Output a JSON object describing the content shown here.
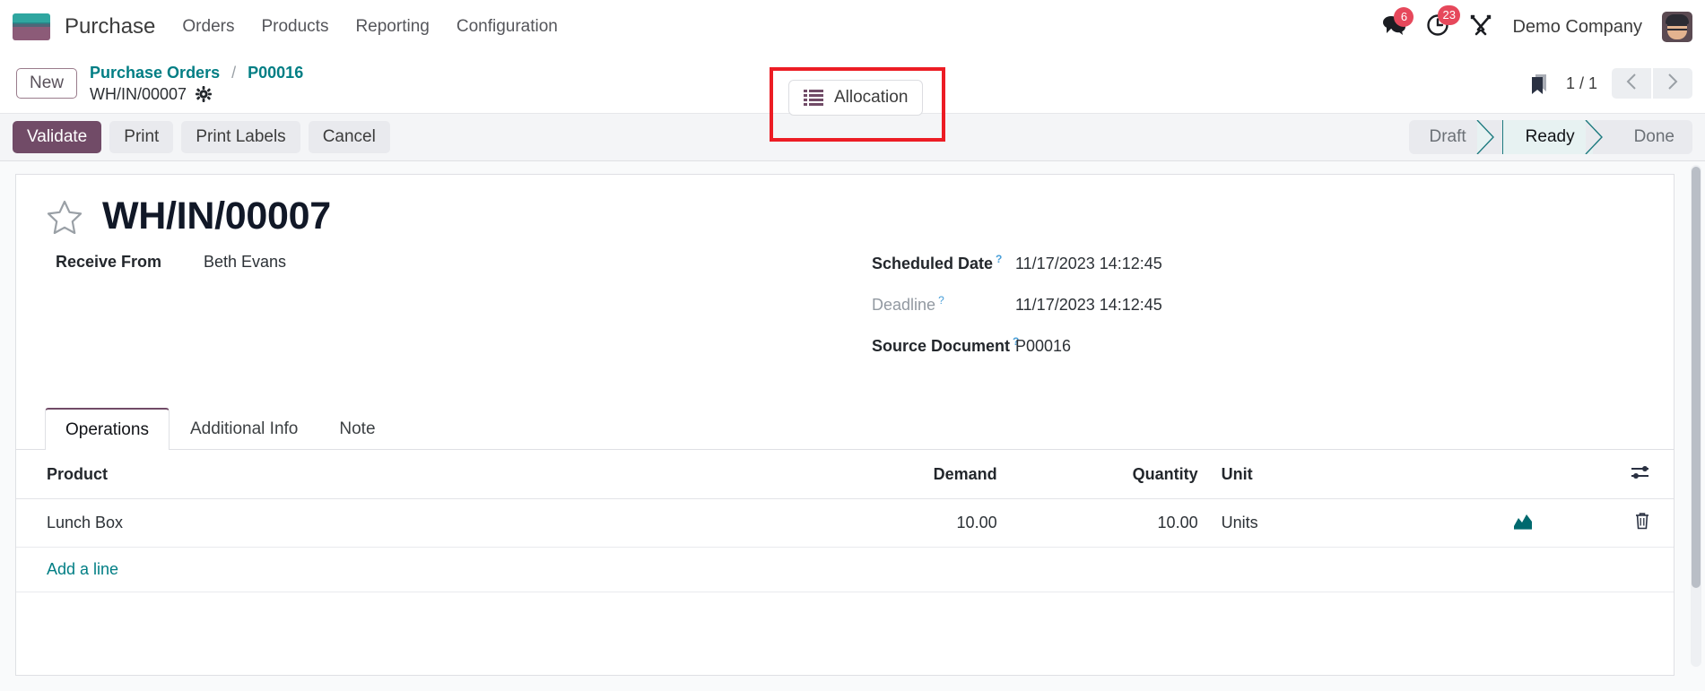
{
  "navbar": {
    "app_logo_icon": "purchase-app-logo",
    "app_title": "Purchase",
    "menu": [
      {
        "label": "Orders"
      },
      {
        "label": "Products"
      },
      {
        "label": "Reporting"
      },
      {
        "label": "Configuration"
      }
    ],
    "messages": {
      "icon": "chat-bubbles-icon",
      "count": "6"
    },
    "activities": {
      "icon": "clock-icon",
      "count": "23"
    },
    "tools": {
      "icon": "tools-wrench-icon"
    },
    "company": "Demo Company",
    "avatar_icon": "user-avatar"
  },
  "breadcrumb": {
    "new_button": "New",
    "links": [
      {
        "label": "Purchase Orders"
      },
      {
        "label": "P00016"
      }
    ],
    "separator": "/",
    "current": "WH/IN/00007",
    "settings_icon": "gear-icon"
  },
  "allocation": {
    "label": "Allocation",
    "icon": "list-lines-icon",
    "highlight_color": "#ec1c24"
  },
  "pager": {
    "bookmark_icon": "bookmark-icon",
    "count": "1 / 1",
    "prev_icon": "chevron-left-icon",
    "next_icon": "chevron-right-icon"
  },
  "actions": {
    "primary": "Validate",
    "secondary": [
      {
        "label": "Print"
      },
      {
        "label": "Print Labels"
      },
      {
        "label": "Cancel"
      }
    ],
    "primary_color": "#714b67"
  },
  "status": {
    "items": [
      {
        "label": "Draft",
        "active": false
      },
      {
        "label": "Ready",
        "active": true
      },
      {
        "label": "Done",
        "active": false
      }
    ],
    "active_color": "#1d7a7f"
  },
  "record": {
    "favorite_icon": "star-outline-icon",
    "title": "WH/IN/00007",
    "left_fields": [
      {
        "label": "Receive From",
        "value": "Beth Evans",
        "help": false,
        "muted": false
      }
    ],
    "right_fields": [
      {
        "label": "Scheduled Date",
        "value": "11/17/2023 14:12:45",
        "help": "?",
        "muted": false
      },
      {
        "label": "Deadline",
        "value": "11/17/2023 14:12:45",
        "help": "?",
        "muted": true
      },
      {
        "label": "Source Document",
        "value": "P00016",
        "help": "?",
        "muted": false
      }
    ]
  },
  "tabs": [
    {
      "label": "Operations",
      "active": true
    },
    {
      "label": "Additional Info",
      "active": false
    },
    {
      "label": "Note",
      "active": false
    }
  ],
  "table": {
    "columns": {
      "product": "Product",
      "demand": "Demand",
      "quantity": "Quantity",
      "unit": "Unit"
    },
    "options_icon": "column-options-icon",
    "rows": [
      {
        "product": "Lunch Box",
        "demand": "10.00",
        "quantity": "10.00",
        "unit": "Units",
        "chart_icon": "forecast-chart-icon",
        "delete_icon": "trash-icon"
      }
    ],
    "add_line": "Add a line"
  }
}
